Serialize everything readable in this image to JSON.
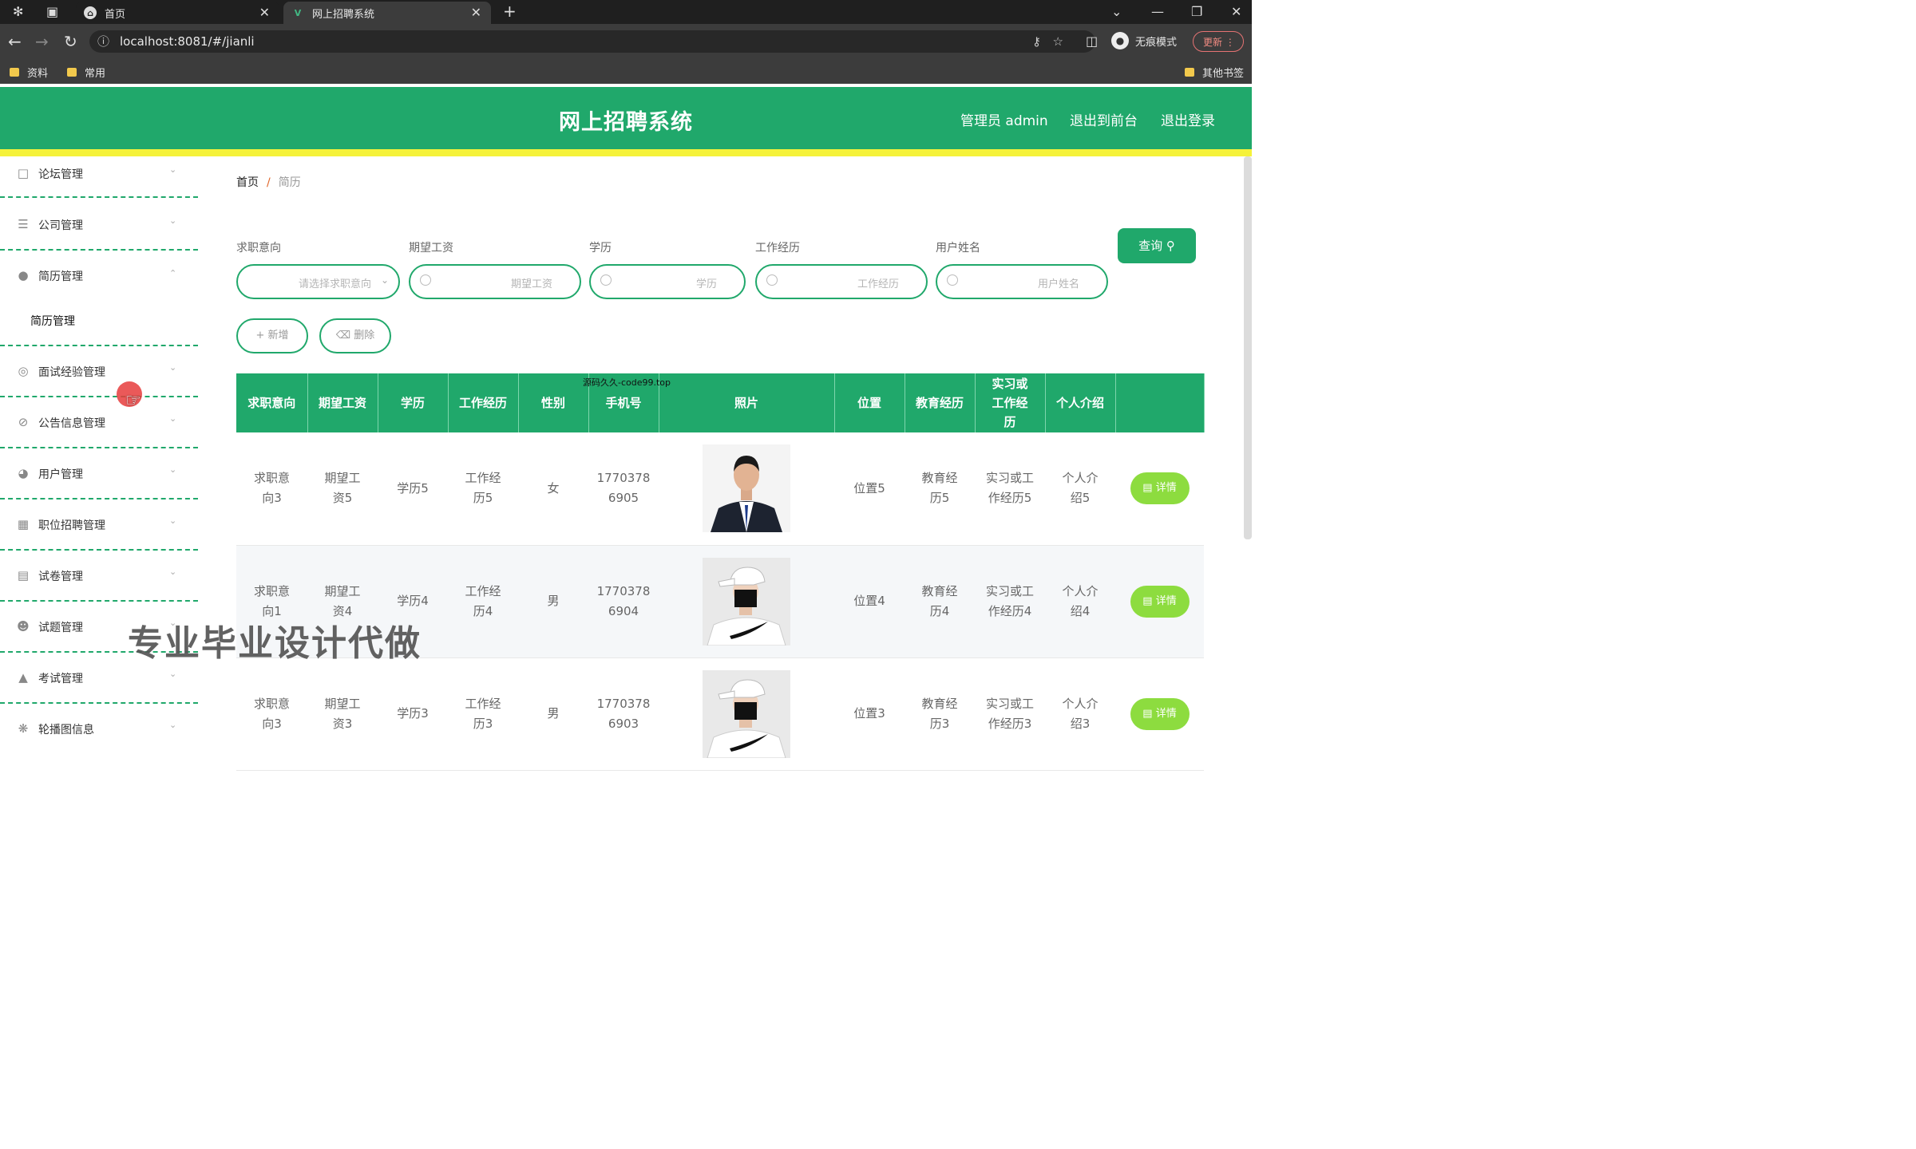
{
  "browser": {
    "tabs": [
      {
        "label": "首页",
        "active": false
      },
      {
        "label": "网上招聘系统",
        "active": true
      }
    ],
    "url": "localhost:8081/#/jianli",
    "incognito_label": "无痕模式",
    "update_label": "更新",
    "bookmarks": [
      "资料",
      "常用"
    ],
    "other_bookmarks": "其他书签"
  },
  "header": {
    "title": "网上招聘系统",
    "admin_label": "管理员 admin",
    "to_front_label": "退出到前台",
    "logout_label": "退出登录"
  },
  "sidebar": {
    "items": [
      {
        "label": "论坛管理",
        "icon": "forum-icon",
        "expanded": false
      },
      {
        "label": "公司管理",
        "icon": "list-icon",
        "expanded": false
      },
      {
        "label": "简历管理",
        "icon": "bulb-icon",
        "expanded": true
      },
      {
        "label": "面试经验管理",
        "icon": "target-icon",
        "expanded": false
      },
      {
        "label": "公告信息管理",
        "icon": "bell-off-icon",
        "expanded": false
      },
      {
        "label": "用户管理",
        "icon": "compass-icon",
        "expanded": false
      },
      {
        "label": "职位招聘管理",
        "icon": "grid-icon",
        "expanded": false
      },
      {
        "label": "试卷管理",
        "icon": "clipboard-icon",
        "expanded": false
      },
      {
        "label": "试题管理",
        "icon": "user-icon",
        "expanded": false
      },
      {
        "label": "考试管理",
        "icon": "chart-icon",
        "expanded": false
      },
      {
        "label": "轮播图信息",
        "icon": "dial-icon",
        "expanded": false
      }
    ],
    "submenu_label": "简历管理"
  },
  "breadcrumb": {
    "home": "首页",
    "current": "简历"
  },
  "filters": [
    {
      "label": "求职意向",
      "placeholder": "请选择求职意向",
      "type": "select"
    },
    {
      "label": "期望工资",
      "placeholder": "期望工资",
      "type": "search"
    },
    {
      "label": "学历",
      "placeholder": "学历",
      "type": "search"
    },
    {
      "label": "工作经历",
      "placeholder": "工作经历",
      "type": "search"
    },
    {
      "label": "用户姓名",
      "placeholder": "用户姓名",
      "type": "search"
    }
  ],
  "buttons": {
    "query": "查询",
    "add": "新增",
    "delete": "删除",
    "detail": "详情"
  },
  "table": {
    "headers": [
      "求职意向",
      "期望工资",
      "学历",
      "工作经历",
      "性别",
      "手机号",
      "照片",
      "位置",
      "教育经历",
      "实习或工作经历",
      "个人介绍",
      ""
    ],
    "rows": [
      {
        "intent": "求职意向3",
        "salary": "期望工资5",
        "edu": "学历5",
        "work": "工作经历5",
        "gender": "女",
        "phone": "17703786905",
        "photo": "suit-man-photo",
        "position": "位置5",
        "education": "教育经历5",
        "internship": "实习或工作经历5",
        "intro": "个人介绍5"
      },
      {
        "intent": "求职意向1",
        "salary": "期望工资4",
        "edu": "学历4",
        "work": "工作经历4",
        "gender": "男",
        "phone": "17703786904",
        "photo": "cap-man-photo",
        "position": "位置4",
        "education": "教育经历4",
        "internship": "实习或工作经历4",
        "intro": "个人介绍4"
      },
      {
        "intent": "求职意向3",
        "salary": "期望工资3",
        "edu": "学历3",
        "work": "工作经历3",
        "gender": "男",
        "phone": "17703786903",
        "photo": "cap-man-photo",
        "position": "位置3",
        "education": "教育经历3",
        "internship": "实习或工作经历3",
        "intro": "个人介绍3"
      }
    ]
  },
  "watermark": "源码久久-code99.top",
  "overlay": "专业毕业设计代做",
  "colors": {
    "primary": "#20a86b",
    "accent_line": "#f5f23a",
    "detail_button": "#8ddc3f"
  }
}
